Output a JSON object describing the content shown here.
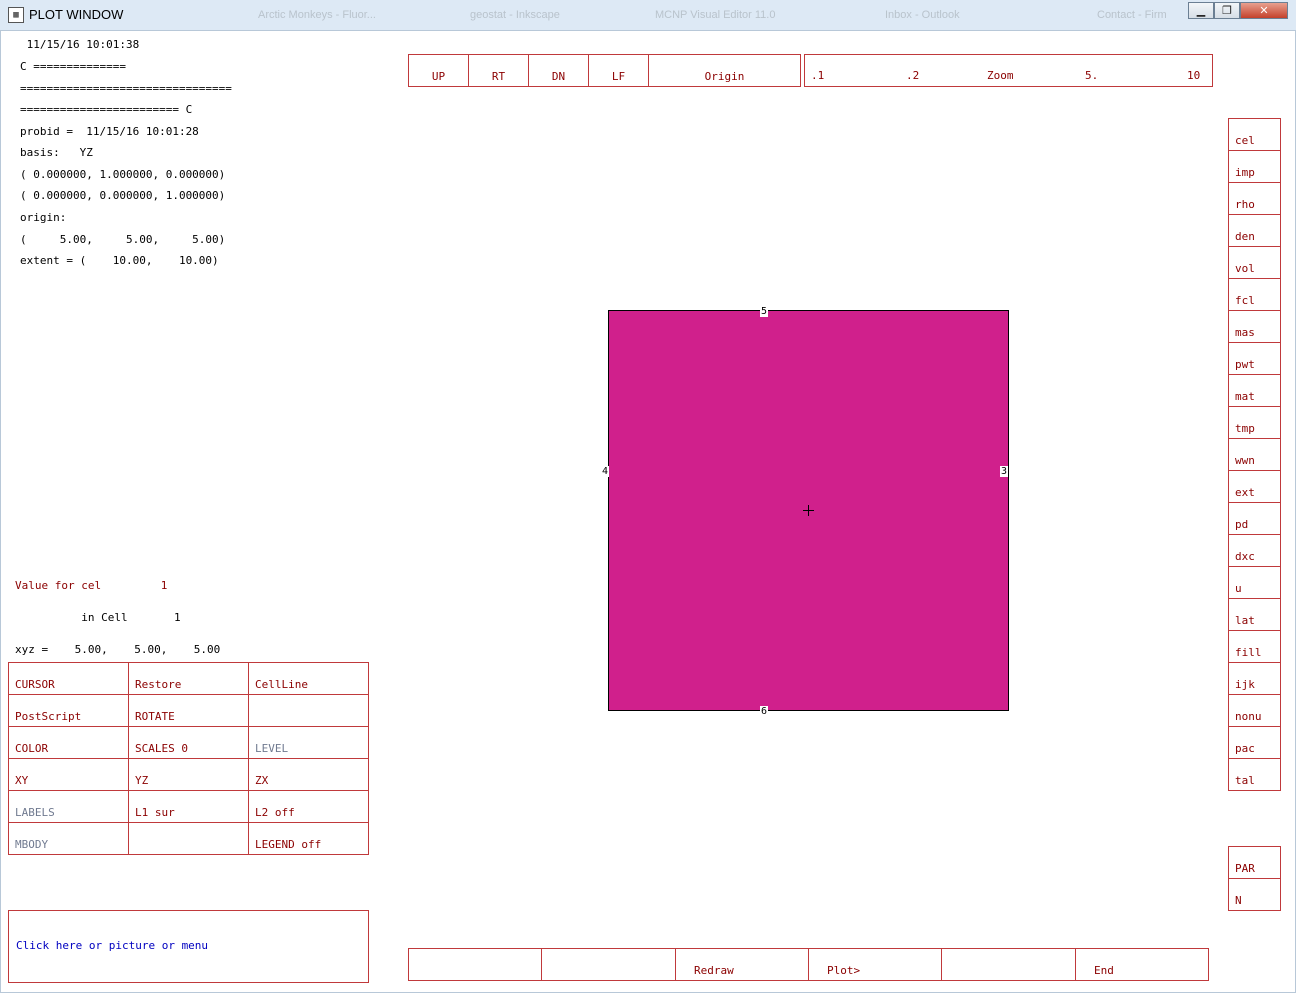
{
  "window": {
    "title": "PLOT WINDOW"
  },
  "taskbar_ghost": [
    "Arctic Monkeys - Fluor...",
    "geostat - Inkscape",
    "MCNP Visual Editor 11.0",
    "Inbox - Outlook",
    "Contact - Firm"
  ],
  "info": {
    "datetime": " 11/15/16 10:01:38",
    "lines": [
      "C ==============",
      "================================",
      "======================== C",
      "probid =  11/15/16 10:01:28",
      "basis:   YZ",
      "( 0.000000, 1.000000, 0.000000)",
      "( 0.000000, 0.000000, 1.000000)",
      "origin:",
      "(     5.00,     5.00,     5.00)",
      "extent = (    10.00,    10.00)"
    ]
  },
  "status": {
    "value_line": "Value for cel         1",
    "cell_line": "          in Cell       1",
    "xyz_line": "xyz =    5.00,    5.00,    5.00"
  },
  "nav": {
    "up": "UP",
    "rt": "RT",
    "dn": "DN",
    "lf": "LF",
    "origin": "Origin"
  },
  "zoom": {
    "t1": ".1",
    "t2": ".2",
    "label": "Zoom",
    "t3": "5.",
    "t4": "10"
  },
  "menu": [
    [
      "CURSOR",
      "Restore",
      "CellLine"
    ],
    [
      "PostScript",
      "ROTATE",
      ""
    ],
    [
      "COLOR",
      "SCALES 0",
      "LEVEL"
    ],
    [
      "XY",
      "YZ",
      "ZX"
    ],
    [
      "LABELS",
      "L1 sur",
      "L2 off"
    ],
    [
      "MBODY",
      "",
      "LEGEND off"
    ]
  ],
  "menu_gray": [
    [
      false,
      false,
      false
    ],
    [
      false,
      false,
      false
    ],
    [
      false,
      false,
      true
    ],
    [
      false,
      false,
      false
    ],
    [
      true,
      false,
      false
    ],
    [
      true,
      false,
      false
    ]
  ],
  "message": "Click here or picture or menu",
  "right_menu": [
    "cel",
    "imp",
    "rho",
    "den",
    "vol",
    "fcl",
    "mas",
    "pwt",
    "mat",
    "tmp",
    "wwn",
    "ext",
    "pd",
    "dxc",
    "u",
    "lat",
    "fill",
    "ijk",
    "nonu",
    "pac",
    "tal"
  ],
  "right_menu2": [
    "PAR",
    "N"
  ],
  "bottom": [
    "",
    "",
    "Redraw",
    "Plot>",
    "",
    "End"
  ],
  "plot": {
    "fill_color": "#d0208c",
    "edge_top": "5",
    "edge_bottom": "6",
    "edge_left": "4",
    "edge_right": "3"
  }
}
